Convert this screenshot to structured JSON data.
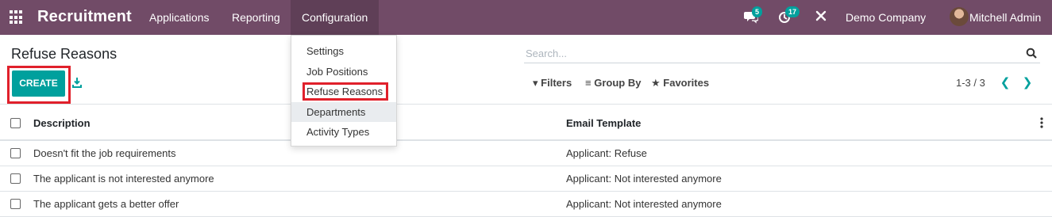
{
  "navbar": {
    "app_name": "Recruitment",
    "menu": [
      {
        "label": "Applications"
      },
      {
        "label": "Reporting"
      },
      {
        "label": "Configuration",
        "active": true
      }
    ],
    "messages_count": "5",
    "activities_count": "17",
    "company": "Demo Company",
    "user": "Mitchell Admin",
    "colors": {
      "brand": "#714B67",
      "accent": "#00A09D"
    }
  },
  "control_panel": {
    "title": "Refuse Reasons",
    "create_label": "CREATE",
    "search_placeholder": "Search...",
    "filters_label": "Filters",
    "groupby_label": "Group By",
    "favorites_label": "Favorites",
    "pager": "1-3 / 3"
  },
  "dropdown": {
    "items": [
      {
        "label": "Settings"
      },
      {
        "label": "Job Positions"
      },
      {
        "label": "Refuse Reasons",
        "highlighted": true
      },
      {
        "label": "Departments",
        "hovered": true
      },
      {
        "label": "Activity Types"
      }
    ]
  },
  "table": {
    "columns": [
      "Description",
      "Email Template"
    ],
    "rows": [
      {
        "description": "Doesn't fit the job requirements",
        "email_template": "Applicant: Refuse"
      },
      {
        "description": "The applicant is not interested anymore",
        "email_template": "Applicant: Not interested anymore"
      },
      {
        "description": "The applicant gets a better offer",
        "email_template": "Applicant: Not interested anymore"
      }
    ]
  }
}
